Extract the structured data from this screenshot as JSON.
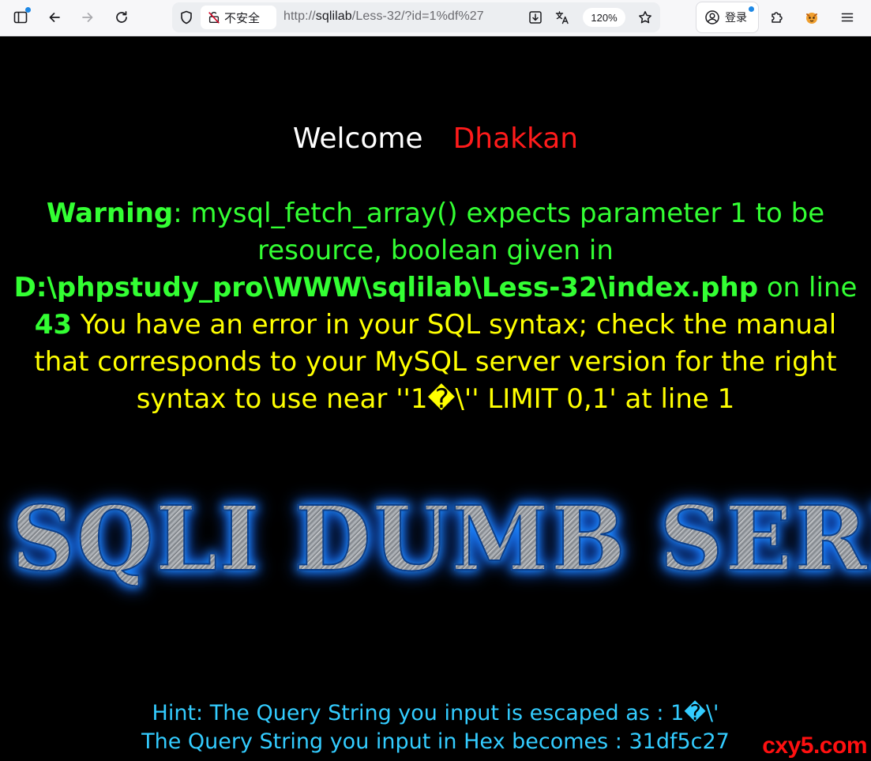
{
  "browser": {
    "security_label": "不安全",
    "url_prefix": "http://",
    "url_host": "sqlilab",
    "url_path": "/Less-32/?id=1%df%27",
    "zoom": "120%",
    "login_label": "登录"
  },
  "page": {
    "welcome_label": "Welcome",
    "welcome_name": "Dhakkan",
    "warning_label": "Warning",
    "warning_message": ": mysql_fetch_array() expects parameter 1 to be resource, boolean given in ",
    "warning_file": "D:\\phpstudy_pro\\WWW\\sqlilab\\Less-32\\index.php",
    "warning_online": " on line ",
    "warning_line": "43",
    "sql_error": "You have an error in your SQL syntax; check the manual that corresponds to your MySQL server version for the right syntax to use near ''1�\\'' LIMIT 0,1' at line 1",
    "banner_text": "SQLI DUMB SERIES",
    "hint_escaped": "Hint: The Query String you input is escaped as : 1�\\'",
    "hint_hex": "The Query String you input in Hex becomes : 31df5c27"
  },
  "watermark": "cxy5.com",
  "colors": {
    "welcome": "#ffffff",
    "name": "#ff1b1b",
    "warning": "#33ff33",
    "sql_error": "#ffff00",
    "hint": "#33ccff",
    "watermark": "#ff1010"
  }
}
